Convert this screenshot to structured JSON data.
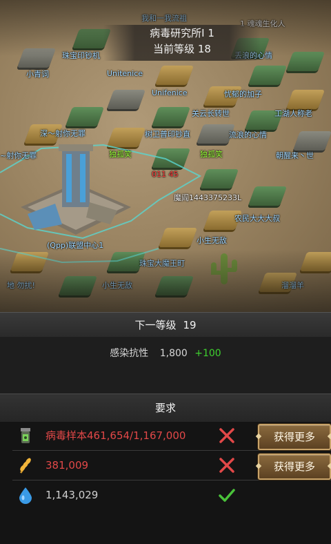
{
  "header": {
    "building_title": "病毒研究所I 1",
    "current_level": "当前等级 18"
  },
  "map": {
    "labels": [
      {
        "text": "我和一我流祖",
        "color": "blue"
      },
      {
        "text": "1 魂魂生化人",
        "color": "white"
      },
      {
        "text": "珠宝印钞机",
        "color": "blue"
      },
      {
        "text": "丢浪的心情",
        "color": "blue"
      },
      {
        "text": "小青词",
        "color": "blue"
      },
      {
        "text": "Unitenice",
        "color": "blue"
      },
      {
        "text": "Unifenice",
        "color": "blue"
      },
      {
        "text": "忧郁的加子",
        "color": "blue"
      },
      {
        "text": "关云长转世",
        "color": "blue"
      },
      {
        "text": "工湖人称老",
        "color": "blue"
      },
      {
        "text": "深～射你无罪",
        "color": "blue"
      },
      {
        "text": "树卫普印钞直",
        "color": "blue"
      },
      {
        "text": "流浪的心情",
        "color": "blue"
      },
      {
        "text": "独孤笑",
        "color": "green"
      },
      {
        "text": "独孤笑",
        "color": "green"
      },
      {
        "text": "~射你无罪",
        "color": "blue"
      },
      {
        "text": "朝醒来丶世",
        "color": "blue"
      },
      {
        "text": "011 45",
        "color": "red"
      },
      {
        "text": "魔阎1443375233L",
        "color": "white"
      },
      {
        "text": "农民大大大叔",
        "color": "blue"
      },
      {
        "text": "小生无敌",
        "color": "blue"
      },
      {
        "text": "(Qpp)联盟中心1",
        "color": "blue"
      },
      {
        "text": "珠宝大魔王町",
        "color": "blue"
      },
      {
        "text": "地 勿扰!",
        "color": "blue"
      },
      {
        "text": "小生无敌",
        "color": "blue"
      },
      {
        "text": "溜溜羊",
        "color": "blue"
      }
    ]
  },
  "next_level": {
    "label": "下一等级",
    "value": "19"
  },
  "stat": {
    "name": "感染抗性",
    "value": "1,800",
    "bonus": "+100"
  },
  "requirements": {
    "title": "要求",
    "items": [
      {
        "text": "病毒样本461,654/1,167,000",
        "met": false,
        "icon": "virus-sample-icon",
        "button": "获得更多"
      },
      {
        "text": "381,009",
        "met": false,
        "icon": "wheat-icon",
        "button": "获得更多"
      },
      {
        "text": "1,143,029",
        "met": true,
        "icon": "water-drop-icon"
      }
    ]
  },
  "colors": {
    "unmet_text": "#e24848",
    "bonus_green": "#3fd12f",
    "button_gold": "#c9a46a",
    "map_label_blue": "#9fd6ff",
    "map_label_green": "#9aff3a"
  }
}
